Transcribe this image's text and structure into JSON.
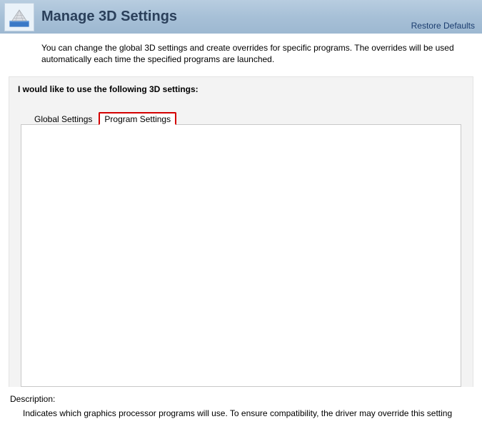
{
  "header": {
    "title": "Manage 3D Settings",
    "restore": "Restore Defaults"
  },
  "intro": "You can change the global 3D settings and create overrides for specific programs. The overrides will be used automatically each time the specified programs are launched.",
  "section_title": "I would like to use the following 3D settings:",
  "tabs": {
    "global": "Global Settings",
    "program": "Program Settings"
  },
  "description": {
    "label": "Description:",
    "text": "Indicates which graphics processor programs will use. To ensure compatibility, the driver may override this setting"
  }
}
